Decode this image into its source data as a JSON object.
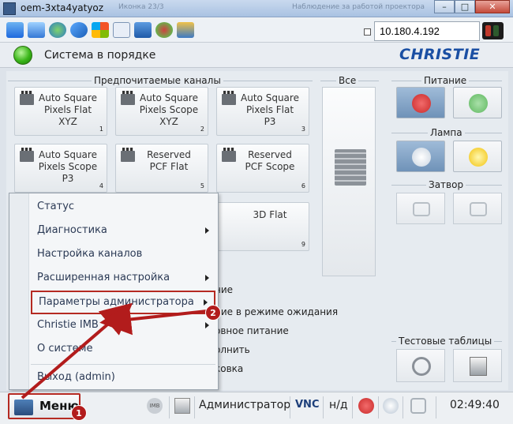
{
  "window": {
    "title": "oem-3xta4yatyoz",
    "ghost_title_1": "Иконка 23/3",
    "ghost_title_2": "Наблюдение за работой проектора",
    "buttons": {
      "minimize": "–",
      "maximize": "□",
      "close": "✕"
    }
  },
  "toolbar": {
    "ip_address": "10.180.4.192",
    "icons": [
      "cad-icon",
      "window-icon",
      "globe-icon",
      "refresh-icon",
      "windows-flag-icon",
      "abc-icon",
      "info-icon",
      "settings-icon",
      "network-icon"
    ]
  },
  "status": {
    "text": "Система в порядке",
    "logo": "CHRISTIE",
    "led_color": "#39b518"
  },
  "channels": {
    "group_label": "Предпочитаемые каналы",
    "all_label": "Все",
    "items": [
      {
        "label": "Auto Square\nPixels Flat\nXYZ",
        "num": "1"
      },
      {
        "label": "Auto Square\nPixels Scope\nXYZ",
        "num": "2"
      },
      {
        "label": "Auto Square\nPixels Flat\nP3",
        "num": "3"
      },
      {
        "label": "Auto Square\nPixels Scope\nP3",
        "num": "4"
      },
      {
        "label": "Reserved\nPCF Flat",
        "num": "5"
      },
      {
        "label": "Reserved\nPCF Scope",
        "num": "6"
      },
      {
        "label": "3D Flat",
        "num": "9"
      }
    ]
  },
  "power": {
    "label": "Питание",
    "on_color": "#c92a2a",
    "off_color": "#5fb85f"
  },
  "lamp": {
    "label": "Лампа"
  },
  "shutter": {
    "label": "Затвор"
  },
  "test_patterns": {
    "label": "Тестовые таблицы"
  },
  "partial_text": {
    "line0": "ние",
    "line1": "ние в режиме ожидания",
    "line2": "овное питание",
    "line3": "олнить",
    "line4": "ковка"
  },
  "menu": {
    "items": [
      {
        "label": "Статус",
        "submenu": false
      },
      {
        "label": "Диагностика",
        "submenu": true
      },
      {
        "label": "Настройка каналов",
        "submenu": false
      },
      {
        "label": "Расширенная настройка",
        "submenu": true
      },
      {
        "label": "Параметры администратора",
        "submenu": true
      },
      {
        "label": "Christie IMB",
        "submenu": true
      },
      {
        "label": "О системе",
        "submenu": false
      },
      {
        "label": "Выход (admin)",
        "submenu": false
      }
    ]
  },
  "callouts": {
    "one": "1",
    "two": "2",
    "color": "#b21c1c"
  },
  "bottombar": {
    "menu_label": "Меню",
    "imb_label": "IMB",
    "user": "Администратор",
    "vnc": "VNC",
    "na": "н/д",
    "time": "02:49:40"
  }
}
